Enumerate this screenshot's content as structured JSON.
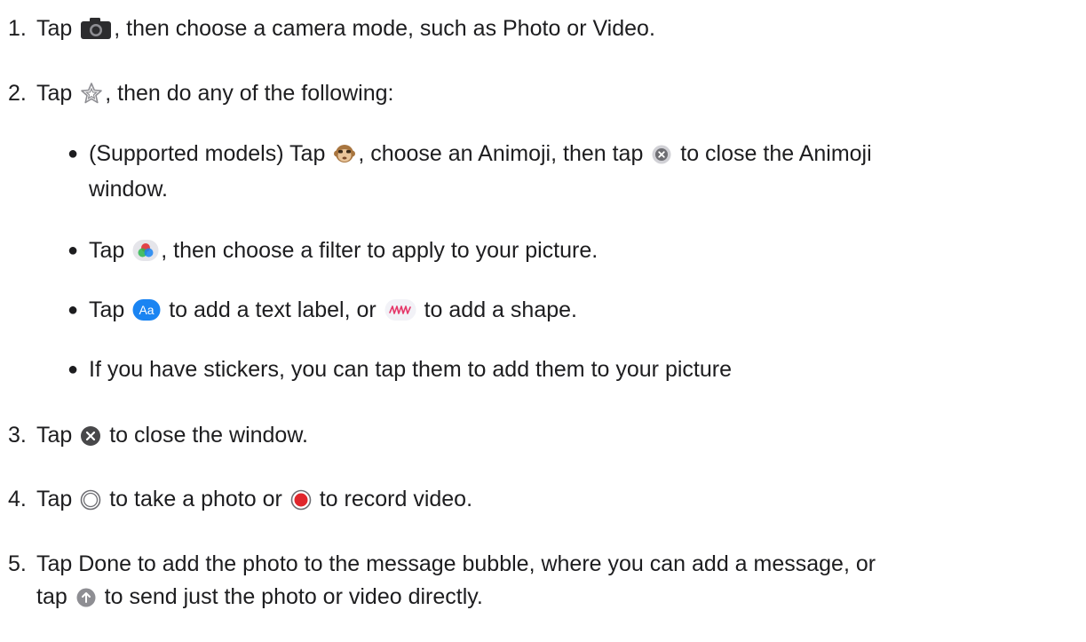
{
  "steps": [
    {
      "num": "1.",
      "a": "Tap",
      "icon": "camera-icon",
      "b": ", then choose a camera mode, such as Photo or Video."
    },
    {
      "num": "2.",
      "a": "Tap",
      "icon": "effects-star-icon",
      "b": ", then do any of the following:",
      "bullets": [
        {
          "a": "(Supported models) Tap",
          "icon1": "animoji-monkey-icon",
          "b": ", choose an Animoji, then tap",
          "icon2": "close-small-icon",
          "c": "to close the Animoji",
          "d": "window."
        },
        {
          "a": "Tap",
          "icon": "filters-icon",
          "b": ", then choose a filter to apply to your picture."
        },
        {
          "a": "Tap",
          "icon1": "text-label-icon",
          "icon1_text": "Aa",
          "b": "to add a text label, or",
          "icon2": "shapes-icon",
          "c": "to add a shape."
        },
        {
          "a": "If you have stickers, you can tap them to add them to your picture"
        }
      ]
    },
    {
      "num": "3.",
      "a": "Tap",
      "icon": "close-icon",
      "b": "to close the window."
    },
    {
      "num": "4.",
      "a": "Tap",
      "icon1": "shutter-icon",
      "b": "to take a photo or",
      "icon2": "record-icon",
      "c": "to record video."
    },
    {
      "num": "5.",
      "a": "Tap Done to add the photo to the message bubble, where you can add a message, or",
      "b": "tap",
      "icon": "send-arrow-icon",
      "c": "to send just the photo or video directly."
    }
  ],
  "colors": {
    "text": "#1d1d1f",
    "accent_blue": "#1a84f2",
    "record_red": "#e0262c",
    "shape_pink": "#e5396a",
    "icon_gray": "#6e6e73"
  }
}
